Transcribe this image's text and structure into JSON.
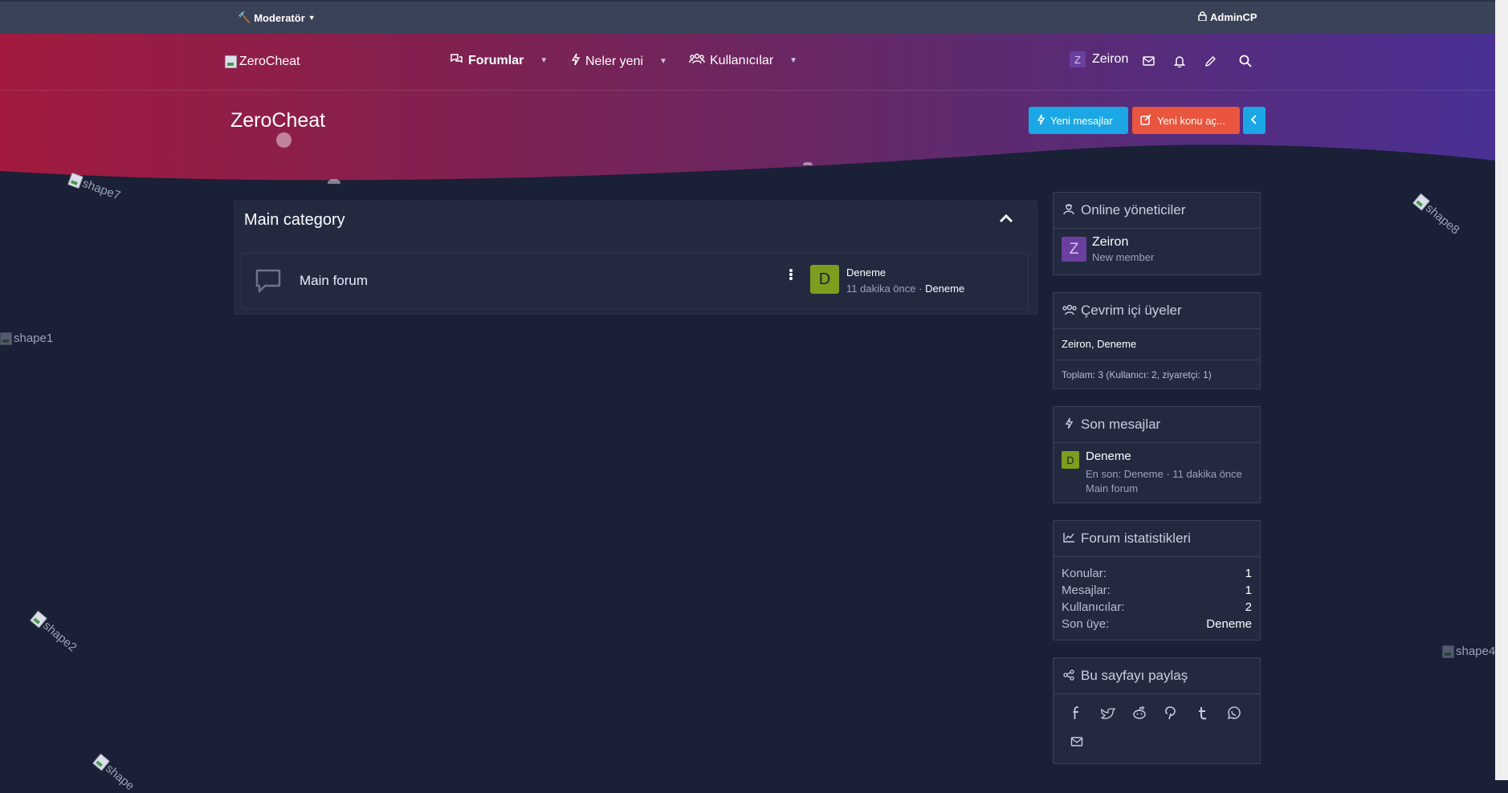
{
  "topbar": {
    "moderator_label": "Moderatör",
    "admin_label": "AdminCP"
  },
  "site": {
    "logo_alt": "ZeroCheat"
  },
  "nav": {
    "items": [
      {
        "label": "Forumlar",
        "icon": "comments-icon",
        "active": true
      },
      {
        "label": "Neler yeni",
        "icon": "bolt-icon",
        "active": false
      },
      {
        "label": "Kullanıcılar",
        "icon": "users-icon",
        "active": false
      }
    ],
    "user": {
      "avatar_letter": "Z",
      "name": "Zeiron"
    }
  },
  "page": {
    "title": "ZeroCheat"
  },
  "buttons": {
    "new_posts": "Yeni mesajlar",
    "new_thread": "Yeni konu aç..."
  },
  "decor": {
    "shape7": "shape7",
    "shape8": "shape8",
    "shape1": "shape1",
    "shape2": "shape2",
    "shape4": "shape4",
    "shape9": "shape"
  },
  "category": {
    "title": "Main category",
    "forum": {
      "name": "Main forum",
      "last_avatar_letter": "D",
      "last_title": "Deneme",
      "last_time": "11 dakika önce",
      "last_user": "Deneme"
    }
  },
  "sidebar": {
    "online_staff": {
      "title": "Online yöneticiler",
      "user_letter": "Z",
      "user_name": "Zeiron",
      "user_role": "New member"
    },
    "online_members": {
      "title": "Çevrim içi üyeler",
      "list": "Zeiron, Deneme",
      "total": "Toplam: 3 (Kullanıcı: 2, ziyaretçi: 1)"
    },
    "latest_posts": {
      "title": "Son mesajlar",
      "avatar_letter": "D",
      "thread_title": "Deneme",
      "meta": "En son: Deneme · 11 dakika önce",
      "forum": "Main forum"
    },
    "stats": {
      "title": "Forum istatistikleri",
      "rows": [
        {
          "label": "Konular:",
          "value": "1"
        },
        {
          "label": "Mesajlar:",
          "value": "1"
        },
        {
          "label": "Kullanıcılar:",
          "value": "2"
        },
        {
          "label": "Son üye:",
          "value": "Deneme"
        }
      ]
    },
    "share": {
      "title": "Bu sayfayı paylaş"
    }
  },
  "colors": {
    "background": "#1a2036",
    "topbar": "#3a4257",
    "hero_start": "#a21a3f",
    "hero_end": "#4a2f93",
    "button_blue": "#1ba7e6",
    "button_red": "#e9553f",
    "avatar_green": "#7b9e1e",
    "avatar_purple": "#6b3fa0"
  }
}
